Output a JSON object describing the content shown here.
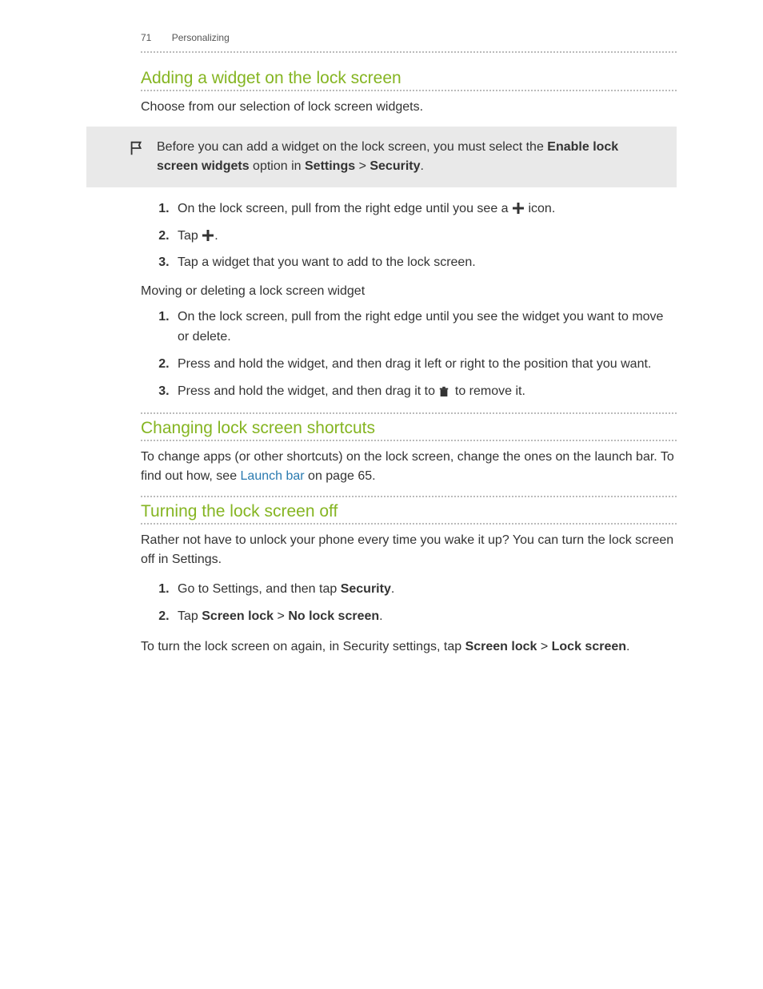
{
  "header": {
    "page_number": "71",
    "section": "Personalizing"
  },
  "sec1": {
    "title": "Adding a widget on the lock screen",
    "intro": "Choose from our selection of lock screen widgets.",
    "note_pre": "Before you can add a widget on the lock screen, you must select the ",
    "note_bold": "Enable lock screen widgets",
    "note_mid": " option in ",
    "note_settings": "Settings",
    "note_gt": " > ",
    "note_security": "Security",
    "note_end": ".",
    "step1_pre": "On the lock screen, pull from the right edge until you see a ",
    "step1_post": " icon.",
    "step2_pre": "Tap ",
    "step2_post": ".",
    "step3": "Tap a widget that you want to add to the lock screen.",
    "sub": "Moving or deleting a lock screen widget",
    "mstep1": "On the lock screen, pull from the right edge until you see the widget you want to move or delete.",
    "mstep2": "Press and hold the widget, and then drag it left or right to the position that you want.",
    "mstep3_pre": "Press and hold the widget, and then drag it to ",
    "mstep3_post": " to remove it."
  },
  "sec2": {
    "title": "Changing lock screen shortcuts",
    "p_pre": "To change apps (or other shortcuts) on the lock screen, change the ones on the launch bar. To find out how, see ",
    "p_link": "Launch bar",
    "p_post": " on page 65."
  },
  "sec3": {
    "title": "Turning the lock screen off",
    "intro": "Rather not have to unlock your phone every time you wake it up? You can turn the lock screen off in Settings.",
    "step1_pre": "Go to Settings, and then tap ",
    "step1_bold": "Security",
    "step1_post": ".",
    "step2_pre": "Tap ",
    "step2_b1": "Screen lock",
    "step2_gt": " > ",
    "step2_b2": "No lock screen",
    "step2_post": ".",
    "outro_pre": "To turn the lock screen on again, in Security settings, tap ",
    "outro_b1": "Screen lock",
    "outro_gt": " > ",
    "outro_b2": "Lock screen",
    "outro_post": "."
  }
}
